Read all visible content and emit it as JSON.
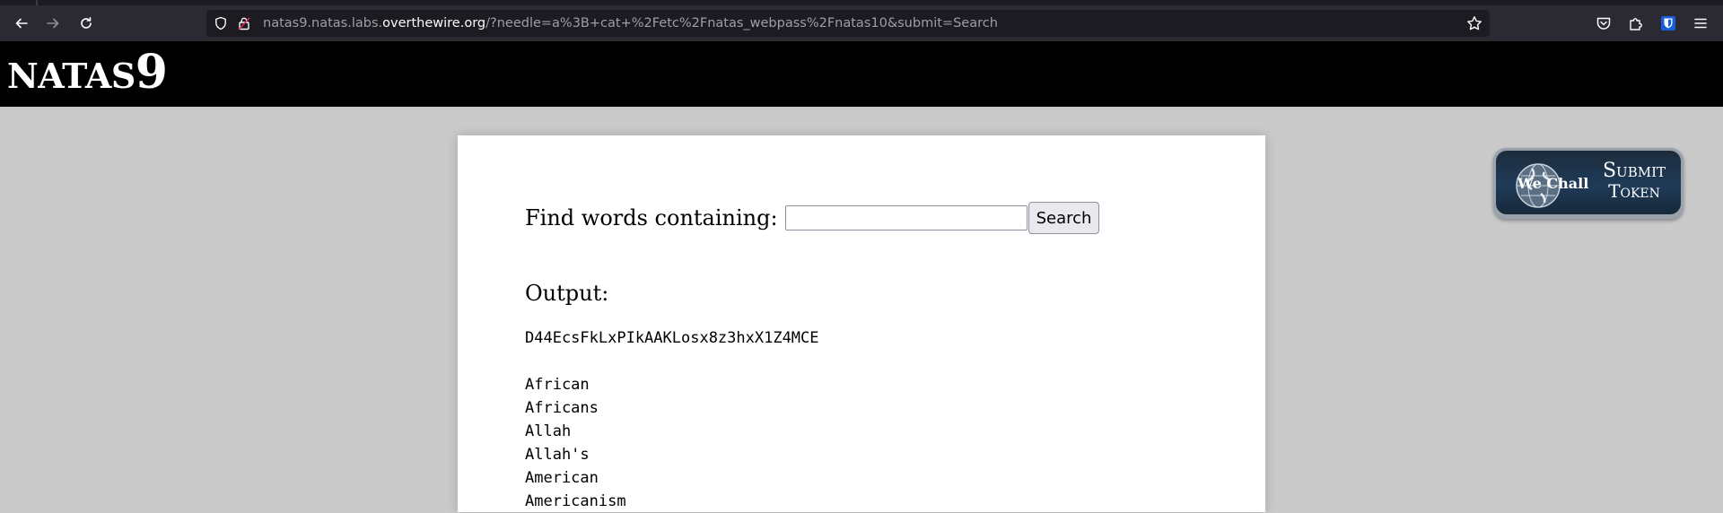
{
  "browser": {
    "url": {
      "prefix": "natas9.natas.labs.",
      "host": "overthewire.org",
      "path": "/?needle=a%3B+cat+%2Fetc%2Fnatas_webpass%2Fnatas10&submit=Search"
    },
    "icons": {
      "back": "back-arrow-icon",
      "forward": "forward-arrow-icon",
      "reload": "reload-icon",
      "shield": "tracking-protection-shield-icon",
      "lock": "insecure-lock-icon",
      "star": "bookmark-star-icon",
      "pocket": "pocket-icon",
      "extensions": "extensions-puzzle-icon",
      "bitwarden": "bitwarden-shield-icon",
      "menu": "hamburger-menu-icon"
    }
  },
  "header": {
    "title_word": "NATAS",
    "title_number": "9"
  },
  "search": {
    "label": "Find words containing:",
    "input_value": "",
    "button_label": "Search"
  },
  "output": {
    "heading": "Output:",
    "lines": [
      "D44EcsFkLxPIkAAKLosx8z3hxX1Z4MCE",
      "",
      "African",
      "Africans",
      "Allah",
      "Allah's",
      "American",
      "Americanism"
    ]
  },
  "token_badge": {
    "brand": "We Chall",
    "line1": "Submit",
    "line2": "Token"
  },
  "colors": {
    "page_background": "#cacaca",
    "header_background": "#000000",
    "panel_background": "#ffffff",
    "browser_toolbar": "#2b2a33",
    "bitwarden_blue": "#175ddc"
  }
}
